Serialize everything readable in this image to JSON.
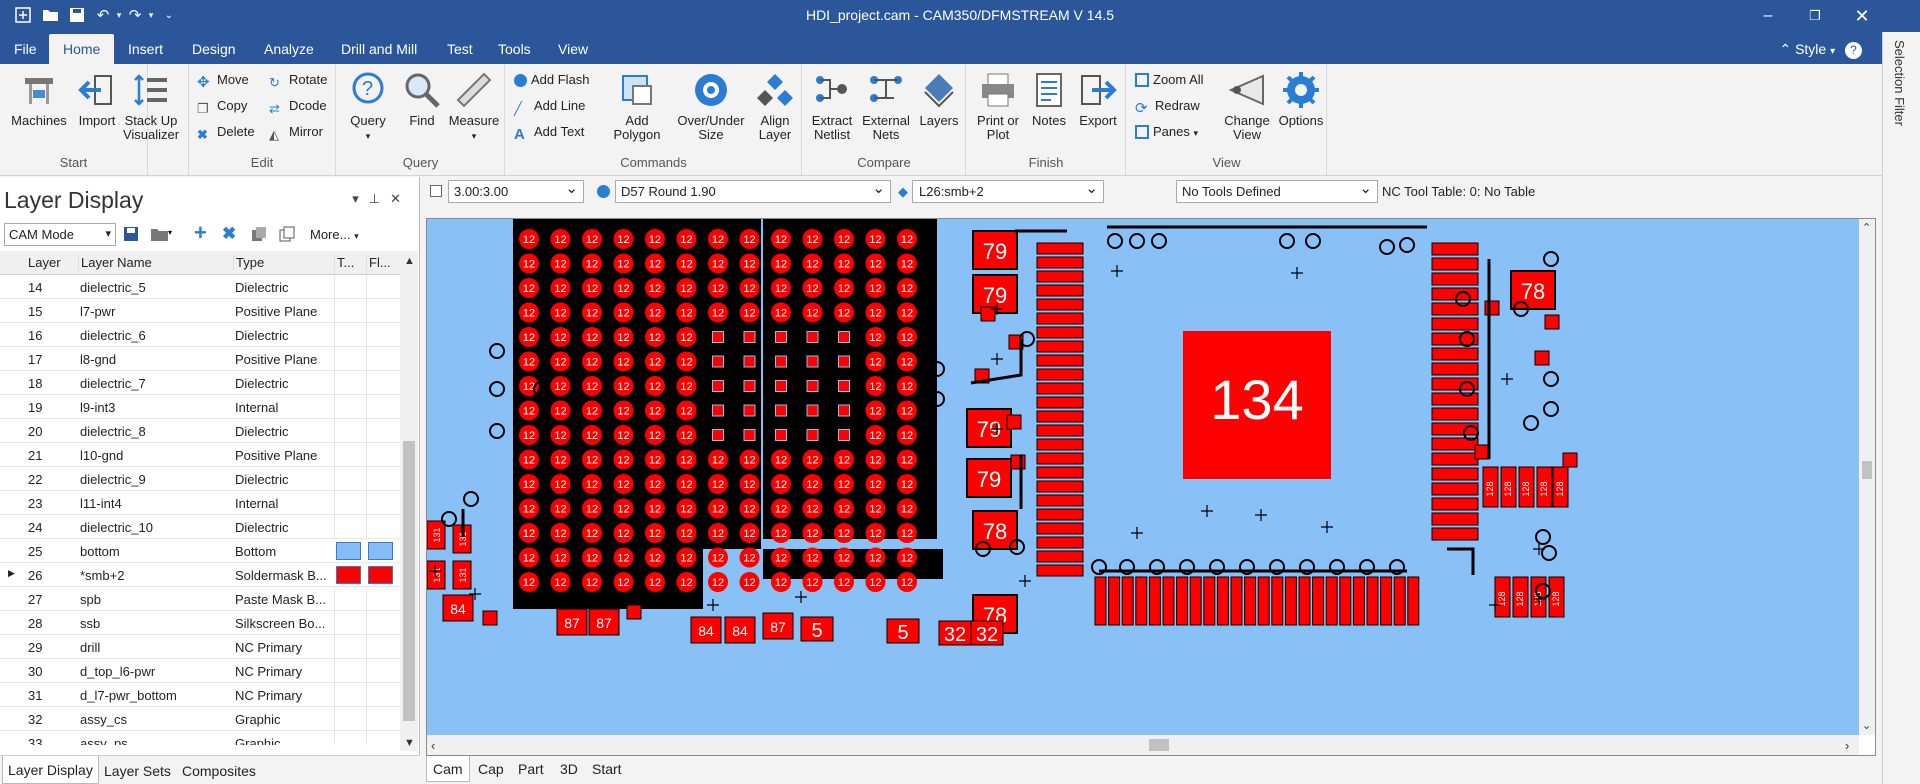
{
  "window": {
    "title": "HDI_project.cam - CAM350/DFMSTREAM V 14.5"
  },
  "menu": {
    "items": [
      "File",
      "Home",
      "Insert",
      "Design",
      "Analyze",
      "Drill and Mill",
      "Test",
      "Tools",
      "View"
    ],
    "style_label": "Style"
  },
  "ribbon": {
    "start": {
      "label": "Start",
      "machines": "Machines",
      "import": "Import",
      "stackup": "Stack Up Visualizer"
    },
    "edit": {
      "label": "Edit",
      "move": "Move",
      "copy": "Copy",
      "delete": "Delete",
      "rotate": "Rotate",
      "dcode": "Dcode",
      "mirror": "Mirror"
    },
    "query": {
      "label": "Query",
      "query": "Query",
      "find": "Find",
      "measure": "Measure"
    },
    "commands": {
      "label": "Commands",
      "add_flash": "Add Flash",
      "add_line": "Add Line",
      "add_text": "Add Text",
      "add_polygon": "Add Polygon",
      "over_under": "Over/Under Size",
      "align": "Align Layer"
    },
    "compare": {
      "label": "Compare",
      "extract": "Extract Netlist",
      "external": "External Nets",
      "layers": "Layers"
    },
    "finish": {
      "label": "Finish",
      "print": "Print or Plot",
      "notes": "Notes",
      "export": "Export"
    },
    "view": {
      "label": "View",
      "zoom_all": "Zoom All",
      "redraw": "Redraw",
      "panes": "Panes",
      "change_view": "Change View",
      "options": "Options"
    }
  },
  "selection_filter": "Selection Filter",
  "layer_panel": {
    "title": "Layer Display",
    "mode": "CAM Mode",
    "more": "More...",
    "columns": [
      "Layer",
      "Layer Name",
      "Type",
      "T...",
      "Fl..."
    ],
    "rows": [
      {
        "num": "14",
        "name": "dielectric_5",
        "type": "Dielectric"
      },
      {
        "num": "15",
        "name": "l7-pwr",
        "type": "Positive Plane"
      },
      {
        "num": "16",
        "name": "dielectric_6",
        "type": "Dielectric"
      },
      {
        "num": "17",
        "name": "l8-gnd",
        "type": "Positive Plane"
      },
      {
        "num": "18",
        "name": "dielectric_7",
        "type": "Dielectric"
      },
      {
        "num": "19",
        "name": "l9-int3",
        "type": "Internal"
      },
      {
        "num": "20",
        "name": "dielectric_8",
        "type": "Dielectric"
      },
      {
        "num": "21",
        "name": "l10-gnd",
        "type": "Positive Plane"
      },
      {
        "num": "22",
        "name": "dielectric_9",
        "type": "Dielectric"
      },
      {
        "num": "23",
        "name": "l11-int4",
        "type": "Internal"
      },
      {
        "num": "24",
        "name": "dielectric_10",
        "type": "Dielectric"
      },
      {
        "num": "25",
        "name": "bottom",
        "type": "Bottom",
        "swatch": "#86bdf6"
      },
      {
        "num": "26",
        "name": "*smb+2",
        "type": "Soldermask B...",
        "swatch": "#ff0000",
        "current": true
      },
      {
        "num": "27",
        "name": "spb",
        "type": "Paste Mask B..."
      },
      {
        "num": "28",
        "name": "ssb",
        "type": "Silkscreen Bo..."
      },
      {
        "num": "29",
        "name": "drill",
        "type": "NC Primary"
      },
      {
        "num": "30",
        "name": "d_top_l6-pwr",
        "type": "NC Primary"
      },
      {
        "num": "31",
        "name": "d_l7-pwr_bottom",
        "type": "NC Primary"
      },
      {
        "num": "32",
        "name": "assy_cs",
        "type": "Graphic"
      },
      {
        "num": "33",
        "name": "assy_ps",
        "type": "Graphic"
      }
    ],
    "tabs": [
      "Layer Display",
      "Layer Sets",
      "Composites"
    ]
  },
  "toolbar": {
    "size": "3.00:3.00",
    "dcode": "D57   Round 1.90",
    "layer": "L26:smb+2",
    "tools": "No Tools Defined",
    "nc_table": "NC Tool Table: 0: No Table"
  },
  "canvas": {
    "labels": {
      "big": "134",
      "bga": "12",
      "pad79": "79",
      "pad78": "78",
      "pad131": "131",
      "pad84": "84",
      "pad87": "87",
      "pad128": "128",
      "pad32": "32",
      "pad5": "5"
    },
    "colors": {
      "background": "#89c0f5",
      "pad": "#ff0000",
      "mask": "#000000"
    }
  },
  "canvas_tabs": [
    "Cam",
    "Cap",
    "Part",
    "3D",
    "Start"
  ]
}
